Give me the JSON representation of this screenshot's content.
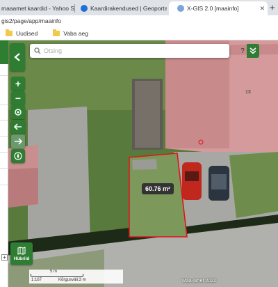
{
  "browser": {
    "tabs": [
      {
        "title": "maaamet kaardid - Yahoo Search",
        "favicon_color": "#6001d2"
      },
      {
        "title": "Kaardirakendused | Geoportaal |",
        "favicon_color": "#1f6fd6"
      },
      {
        "title": "X-GIS 2.0 [maainfo]",
        "favicon_color": "#7aa7d8"
      }
    ],
    "new_tab": "+",
    "address": "gis2/page/app/maainfo",
    "bookmarks": [
      "Uudised",
      "Vaba aeg"
    ]
  },
  "search": {
    "placeholder": "Otsing",
    "help": "?"
  },
  "map": {
    "area_measurement": "60.76 m²",
    "house_number": "13",
    "hybrid_label": "Hübriid",
    "scale_label": "5 m",
    "scale_ratio": "1:167",
    "grid_label": "Kõrgusväli:3 m",
    "copyright": "Maa-amet 2022",
    "colors": {
      "measure_outline": "#e0141e",
      "accent": "#2e7d32"
    }
  },
  "controls": {
    "zoom_in": "+",
    "zoom_out": "−",
    "small_plus": "+"
  }
}
